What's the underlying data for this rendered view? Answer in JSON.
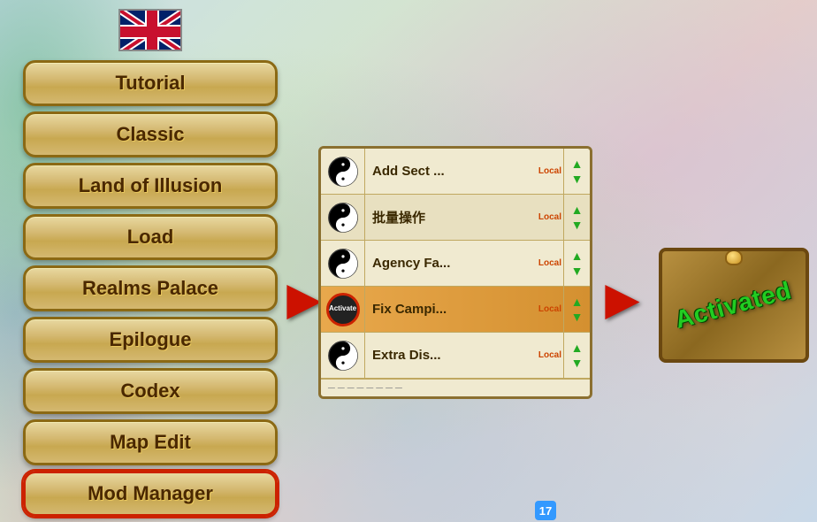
{
  "background": {
    "color": "#b8d4e8"
  },
  "flag": {
    "alt": "UK Flag"
  },
  "menu": {
    "items": [
      {
        "id": "tutorial",
        "label": "Tutorial",
        "active": false
      },
      {
        "id": "classic",
        "label": "Classic",
        "active": false
      },
      {
        "id": "land-of-illusion",
        "label": "Land of Illusion",
        "active": false
      },
      {
        "id": "load",
        "label": "Load",
        "active": false
      },
      {
        "id": "realms-palace",
        "label": "Realms Palace",
        "active": false
      },
      {
        "id": "epilogue",
        "label": "Epilogue",
        "active": false
      },
      {
        "id": "codex",
        "label": "Codex",
        "active": false
      },
      {
        "id": "map-edit",
        "label": "Map Edit",
        "active": false
      },
      {
        "id": "mod-manager",
        "label": "Mod Manager",
        "active": true
      }
    ]
  },
  "mod_panel": {
    "items": [
      {
        "id": "add-sect",
        "icon": "yin-yang",
        "name": "Add Sect ...",
        "tag": "Local",
        "highlighted": false
      },
      {
        "id": "batch-ops",
        "icon": "yin-yang",
        "name": "批量操作",
        "tag": "Local",
        "highlighted": false
      },
      {
        "id": "agency-fa",
        "icon": "yin-yang",
        "name": "Agency Fa...",
        "tag": "Local",
        "highlighted": false
      },
      {
        "id": "fix-campi",
        "icon": "activate",
        "name": "Fix Campi...",
        "tag": "Local",
        "highlighted": true
      },
      {
        "id": "extra-dis",
        "icon": "yin-yang",
        "name": "Extra Dis...",
        "tag": "Local",
        "highlighted": false
      }
    ],
    "partial_row": "..."
  },
  "arrows": {
    "left_arrow": "▶",
    "right_arrow": "▶"
  },
  "right_panel": {
    "activated_text": "Activated",
    "orb": "gold"
  },
  "number_badge": {
    "value": "17"
  },
  "activate_icon_label": "Activate"
}
